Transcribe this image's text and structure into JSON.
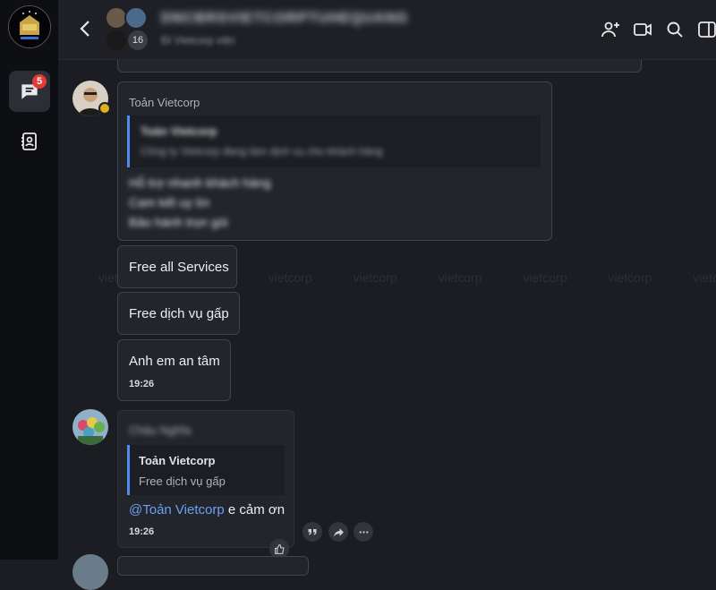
{
  "sidebar": {
    "unread_count": "5"
  },
  "header": {
    "group_name": "DNCBRSVIETCORPTUHEQUANG",
    "subtitle": "Đi Vietcorp việc",
    "member_count": "16"
  },
  "watermark_text": "vietcorp vietcorp vietcorp vietcorp vietcorp vietcorp vietcorp vietcorp vietcorp",
  "messages": [
    {
      "sender": "Toản Vietcorp",
      "quote_author": "Toản Vietcorp",
      "quote_text": "Công ty Vietcorp đang làm dịch vụ cho khách hàng",
      "body_lines": [
        "Hỗ trợ nhanh khách hàng",
        "Cam kết uy tín",
        "Bảo hành trọn gói"
      ]
    },
    {
      "text": "Free all Services"
    },
    {
      "text": "Free dịch vụ gấp"
    },
    {
      "text": "Anh em an tâm",
      "time": "19:26"
    },
    {
      "sender": "Châu Nghĩa",
      "quote_author": "Toản Vietcorp",
      "quote_text": "Free dịch vụ gấp",
      "mention": "@Toản Vietcorp",
      "text": " e cảm ơn",
      "time": "19:26"
    }
  ],
  "colors": {
    "accent": "#4e8cf0",
    "mention": "#6aa0f0",
    "badge": "#e53935",
    "bubble_border": "#3c4452"
  },
  "icons": [
    "chat-icon",
    "contacts-icon",
    "back-icon",
    "add-member-icon",
    "video-call-icon",
    "search-icon",
    "panel-toggle-icon",
    "quote-icon",
    "forward-icon",
    "more-icon",
    "like-icon"
  ]
}
